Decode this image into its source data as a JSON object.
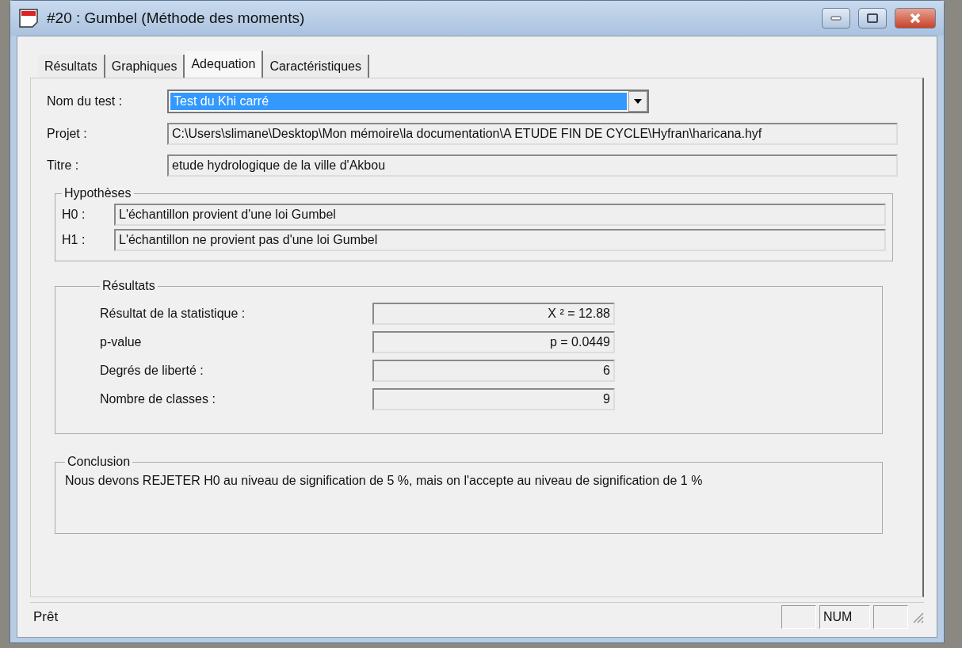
{
  "window": {
    "title": "#20 : Gumbel (Méthode des moments)"
  },
  "tabs": [
    {
      "label": "Résultats",
      "selected": false
    },
    {
      "label": "Graphiques",
      "selected": false
    },
    {
      "label": "Adequation",
      "selected": true
    },
    {
      "label": "Caractéristiques",
      "selected": false
    }
  ],
  "test": {
    "label": "Nom du test :",
    "value": "Test du Khi carré"
  },
  "fields": [
    {
      "label": "Projet :",
      "value": "C:\\Users\\slimane\\Desktop\\Mon mémoire\\la documentation\\A ETUDE FIN DE CYCLE\\Hyfran\\haricana.hyf"
    },
    {
      "label": "Titre :",
      "value": "etude hydrologique de la ville d'Akbou"
    }
  ],
  "hypotheses": {
    "title": "Hypothèses",
    "items": [
      {
        "label": "H0 :",
        "value": "L'échantillon provient d'une loi Gumbel"
      },
      {
        "label": "H1 :",
        "value": "L'échantillon ne provient pas d'une loi Gumbel"
      }
    ]
  },
  "results": {
    "title": "Résultats",
    "items": [
      {
        "label": "Résultat de la statistique :",
        "value": "X ² = 12.88"
      },
      {
        "label": "p-value",
        "value": "p = 0.0449"
      },
      {
        "label": "Degrés de liberté :",
        "value": "6"
      },
      {
        "label": "Nombre de classes :",
        "value": "9"
      }
    ]
  },
  "conclusion": {
    "title": "Conclusion",
    "text": "Nous devons REJETER H0 au niveau de signification de 5 %, mais on l'accepte au niveau de signification de 1 %"
  },
  "status_bar": {
    "text": "Prêt",
    "num_indicator": "NUM"
  }
}
